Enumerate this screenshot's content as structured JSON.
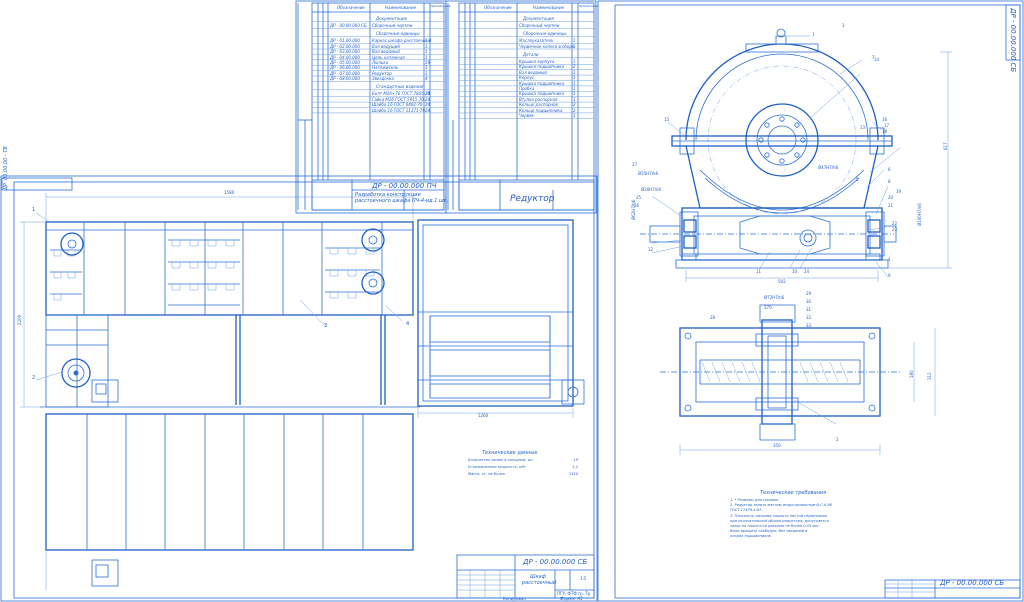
{
  "left_sheet": {
    "stamp_code": "ДР - 00.00.000 СБ",
    "title": "Шкаф\nрасстоечный",
    "scale": "1:5",
    "group": "ПГУ, ФТФ гр. Тр",
    "top_code": "ДР. 00.00.00 - ТВ",
    "tech_title": "Технические данные",
    "tech_rows": [
      {
        "label": "Количество люлек в заходной, шт",
        "value": "19"
      },
      {
        "label": "Установленная мощность, кВт",
        "value": "2,2"
      },
      {
        "label": "Масса, кг, не более",
        "value": "1320"
      }
    ],
    "callouts": [
      "1",
      "2",
      "3",
      "4"
    ],
    "dims": {
      "width": "1580",
      "height": "2200",
      "side_width": "1260"
    },
    "footer": [
      "Копировал",
      "Формат А1"
    ]
  },
  "spec_sheet_1": {
    "code": "ДР - 00.00.000 ПЧ",
    "title": "Разработка конструкции\nрасстоечного шкафа ПЧ-4-ид.1 шт.",
    "col_headers": [
      "Обозначение",
      "Наименование",
      "Примечание"
    ],
    "sections": [
      {
        "heading": "Документация",
        "rows": [
          {
            "code": "ДР - 00.00.000 СБ",
            "name": "Сборочный чертеж",
            "qty": ""
          }
        ]
      },
      {
        "heading": "Сборочные единицы",
        "rows": [
          {
            "code": "ДР - 01.00.000",
            "name": "Каркас шкафа расстоечный",
            "qty": "1"
          },
          {
            "code": "ДР - 02.00.000",
            "name": "Вал ведущий",
            "qty": "1"
          },
          {
            "code": "ДР - 03.00.000",
            "name": "Вал ведомый",
            "qty": "1"
          },
          {
            "code": "ДР - 04.00.000",
            "name": "Цепь натяжная",
            "qty": "1"
          },
          {
            "code": "ДР - 05.00.000",
            "name": "Люлька",
            "qty": "19"
          },
          {
            "code": "ДР - 06.00.000",
            "name": "Натяжитель",
            "qty": "1"
          },
          {
            "code": "ДР - 07.00.000",
            "name": "Редуктор",
            "qty": "1"
          },
          {
            "code": "ДР - 08.00.000",
            "name": "Звездочка",
            "qty": "4"
          }
        ]
      },
      {
        "heading": "Стандартные изделия",
        "rows": [
          {
            "code": "",
            "name": "Болт М16×70 ГОСТ 7805-70",
            "qty": "24"
          },
          {
            "code": "",
            "name": "Гайка М16 ГОСТ 5915-70",
            "qty": "24"
          },
          {
            "code": "",
            "name": "Шайба 16 ГОСТ 6402-70",
            "qty": "24"
          },
          {
            "code": "",
            "name": "Шайба 16 ГОСТ 11371-78",
            "qty": "24"
          }
        ]
      }
    ]
  },
  "spec_sheet_2": {
    "code": "",
    "title": "Редуктор",
    "col_headers": [
      "Обозначение",
      "Наименование",
      "Примечание"
    ],
    "sections": [
      {
        "heading": "Документация",
        "rows": [
          {
            "code": "",
            "name": "Сборочный чертеж",
            "qty": ""
          }
        ]
      },
      {
        "heading": "Сборочные единицы",
        "rows": [
          {
            "code": "",
            "name": "Маслоуказатель",
            "qty": "1"
          },
          {
            "code": "",
            "name": "Червячное колесо в сборе",
            "qty": "1"
          }
        ]
      },
      {
        "heading": "Детали",
        "rows": [
          {
            "code": "",
            "name": "Крышка корпуса",
            "qty": "1"
          },
          {
            "code": "",
            "name": "Крышка подшипника",
            "qty": "2"
          },
          {
            "code": "",
            "name": "Вал ведомый",
            "qty": "1"
          },
          {
            "code": "",
            "name": "Корпус",
            "qty": "1"
          },
          {
            "code": "",
            "name": "Крышка подшипника",
            "qty": "1"
          },
          {
            "code": "",
            "name": "Пробка",
            "qty": "1"
          },
          {
            "code": "",
            "name": "Крышка подшипника",
            "qty": "1"
          },
          {
            "code": "",
            "name": "Втулка распорная",
            "qty": "1"
          },
          {
            "code": "",
            "name": "Кольцо распорное",
            "qty": "2"
          },
          {
            "code": "",
            "name": "Кольцо подшипника",
            "qty": "2"
          },
          {
            "code": "",
            "name": "Червяк",
            "qty": "1"
          }
        ]
      }
    ]
  },
  "right_sheet": {
    "stamp_code": "ДР - 00.00.000 СБ",
    "side_code": "ДР - 00.00.000 СБ",
    "tech_title": "Технические требования",
    "tech_text": [
      "1. * Размеры для справок.",
      "2. Редуктор залить маслом индустриальным И-Г-А-68",
      "ГОСТ 17479.4-87.",
      "3. Плоскость разъема покрыть пастой герметиком",
      "при окончательной сборке редуктора; допускается",
      "зазор по плоскости разъема не более 0,05 мм.",
      "Валы вращать свободно; без заеданий в",
      "опорах подшипников."
    ],
    "callouts": [
      "1",
      "2",
      "3",
      "4",
      "5",
      "6",
      "7",
      "8",
      "9",
      "10",
      "11",
      "12",
      "13",
      "14",
      "15",
      "16",
      "17",
      "18",
      "19",
      "20",
      "21",
      "22",
      "23",
      "24",
      "25",
      "26",
      "27",
      "28",
      "29",
      "30",
      "31",
      "32",
      "33"
    ],
    "dims": [
      "Ø30H7/k6",
      "Ø35H7/k6",
      "Ø47H7/h6",
      "Ø62H7/h6",
      "Ø100H7/n6",
      "Ø72H7/h6",
      "617",
      "502",
      "180",
      "312",
      "350",
      "370"
    ]
  }
}
